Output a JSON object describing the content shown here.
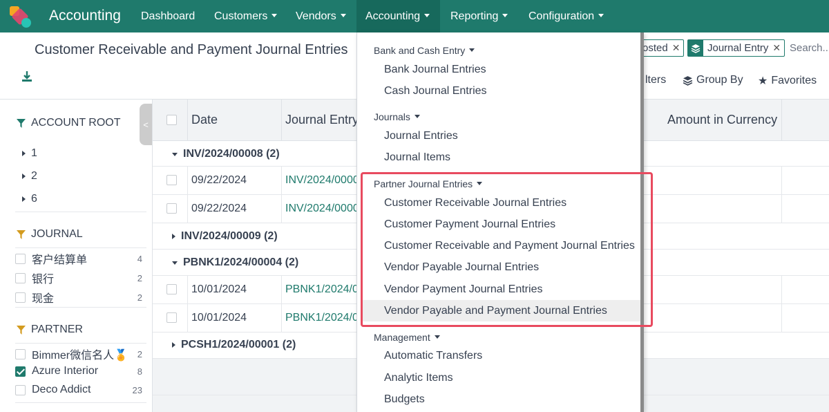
{
  "navbar": {
    "app_name": "Accounting",
    "items": [
      {
        "label": "Dashboard"
      },
      {
        "label": "Customers"
      },
      {
        "label": "Vendors"
      },
      {
        "label": "Accounting"
      },
      {
        "label": "Reporting"
      },
      {
        "label": "Configuration"
      }
    ],
    "color": "#1f7a6c"
  },
  "control_panel": {
    "title": "Customer Receivable and Payment Journal Entries",
    "facets": [
      {
        "label": "osted"
      },
      {
        "label": "Journal Entry"
      }
    ],
    "search_placeholder": "Search...",
    "filters_label": "lters",
    "group_by_label": "Group By",
    "favorites_label": "Favorites"
  },
  "sidebar": {
    "account_root": {
      "title": "ACCOUNT ROOT",
      "items": [
        "1",
        "2",
        "6"
      ]
    },
    "journal": {
      "title": "JOURNAL",
      "items": [
        {
          "label": "客户结算单",
          "count": "4"
        },
        {
          "label": "银行",
          "count": "2"
        },
        {
          "label": "现金",
          "count": "2"
        }
      ]
    },
    "partner": {
      "title": "PARTNER",
      "items": [
        {
          "label": "Bimmer微信名人🏅",
          "count": "2",
          "checked": false
        },
        {
          "label": "Azure Interior",
          "count": "8",
          "checked": true
        },
        {
          "label": "Deco Addict",
          "count": "23",
          "checked": false
        }
      ]
    },
    "collapse_label": "<"
  },
  "list": {
    "columns": {
      "date": "Date",
      "journal_entry": "Journal Entry",
      "amount_currency": "Amount in Currency"
    },
    "groups": [
      {
        "title": "INV/2024/00008 (2)",
        "rows": [
          {
            "date": "09/22/2024",
            "entry": "INV/2024/0000"
          },
          {
            "date": "09/22/2024",
            "entry": "INV/2024/0000"
          }
        ]
      },
      {
        "title": "INV/2024/00009 (2)",
        "rows": []
      },
      {
        "title": "PBNK1/2024/00004 (2)",
        "rows": [
          {
            "date": "10/01/2024",
            "entry": "PBNK1/2024/0"
          },
          {
            "date": "10/01/2024",
            "entry": "PBNK1/2024/0"
          }
        ]
      },
      {
        "title": "PCSH1/2024/00001 (2)",
        "rows": []
      }
    ]
  },
  "dropdown": {
    "sections": [
      {
        "header": "Bank and Cash Entry",
        "items": [
          "Bank Journal Entries",
          "Cash Journal Entries"
        ]
      },
      {
        "header": "Journals",
        "items": [
          "Journal Entries",
          "Journal Items"
        ]
      },
      {
        "header": "Partner Journal Entries",
        "items": [
          "Customer Receivable Journal Entries",
          "Customer Payment Journal Entries",
          "Customer Receivable and Payment Journal Entries",
          "Vendor Payable Journal Entries",
          "Vendor Payment Journal Entries",
          "Vendor Payable and Payment Journal Entries"
        ]
      },
      {
        "header": "Management",
        "items": [
          "Automatic Transfers",
          "Analytic Items",
          "Budgets"
        ]
      }
    ],
    "highlight_color": "#e84a5f"
  }
}
